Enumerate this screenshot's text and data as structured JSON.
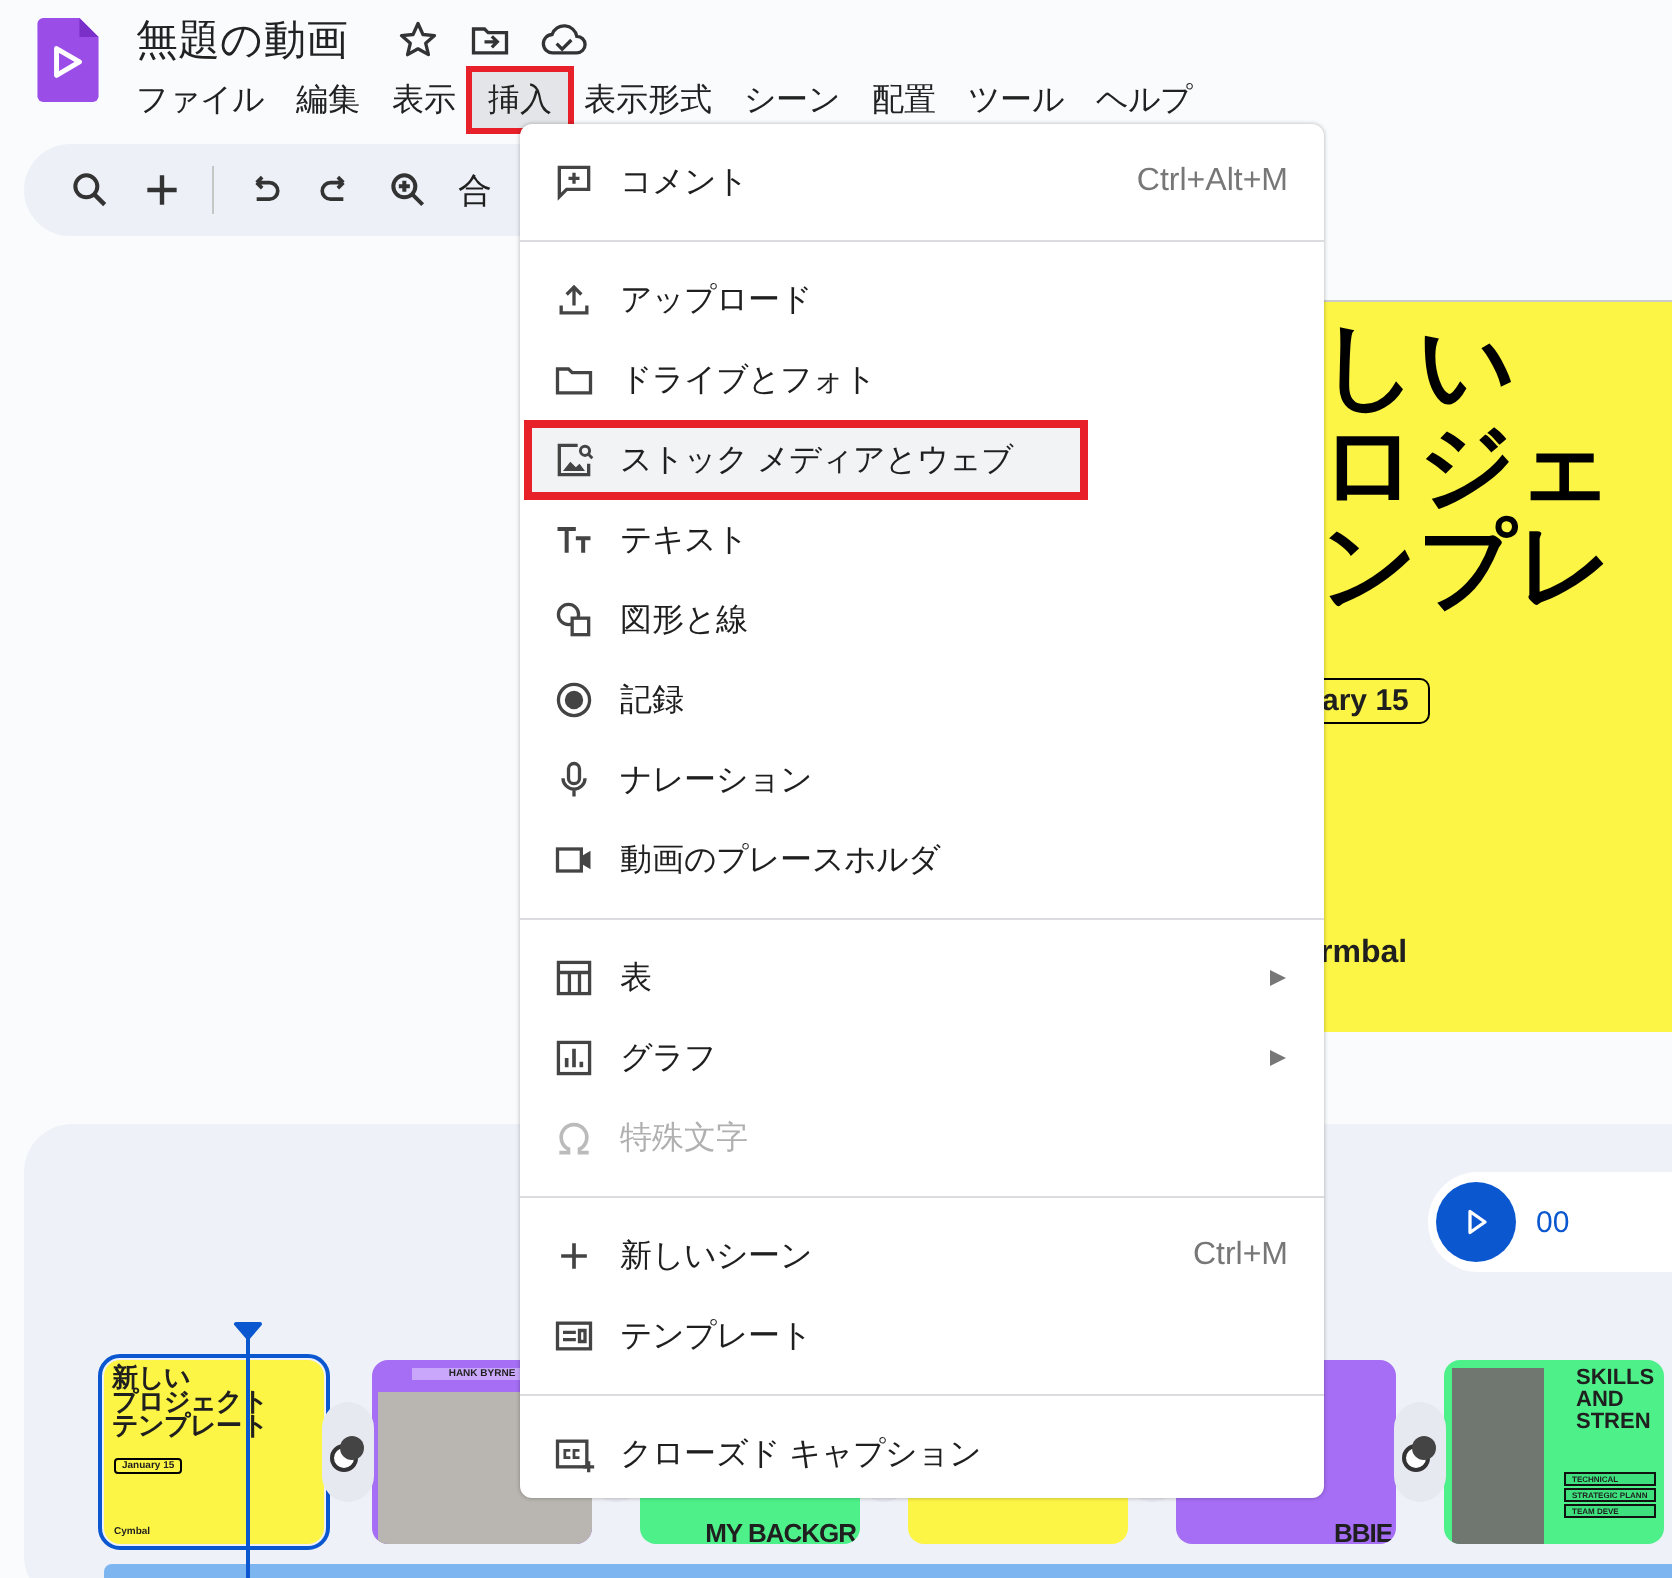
{
  "document": {
    "title": "無題の動画"
  },
  "menubar": [
    {
      "label": "ファイル",
      "selected": false
    },
    {
      "label": "編集",
      "selected": false
    },
    {
      "label": "表示",
      "selected": false
    },
    {
      "label": "挿入",
      "selected": true
    },
    {
      "label": "表示形式",
      "selected": false
    },
    {
      "label": "シーン",
      "selected": false
    },
    {
      "label": "配置",
      "selected": false
    },
    {
      "label": "ツール",
      "selected": false
    },
    {
      "label": "ヘルプ",
      "selected": false
    }
  ],
  "toolbar": {
    "partial_label": "合"
  },
  "insert_menu": {
    "groups": [
      [
        {
          "kind": "comment",
          "label": "コメント",
          "shortcut": "Ctrl+Alt+M",
          "selected": false,
          "disabled": false,
          "submenu": false
        }
      ],
      [
        {
          "kind": "upload",
          "label": "アップロード",
          "selected": false,
          "disabled": false,
          "submenu": false
        },
        {
          "kind": "folder",
          "label": "ドライブとフォト",
          "selected": false,
          "disabled": false,
          "submenu": false
        },
        {
          "kind": "stock",
          "label": "ストック メディアとウェブ",
          "selected": true,
          "disabled": false,
          "submenu": false
        },
        {
          "kind": "text",
          "label": "テキスト",
          "selected": false,
          "disabled": false,
          "submenu": false
        },
        {
          "kind": "shapes",
          "label": "図形と線",
          "selected": false,
          "disabled": false,
          "submenu": false
        },
        {
          "kind": "record",
          "label": "記録",
          "selected": false,
          "disabled": false,
          "submenu": false
        },
        {
          "kind": "mic",
          "label": "ナレーション",
          "selected": false,
          "disabled": false,
          "submenu": false
        },
        {
          "kind": "video",
          "label": "動画のプレースホルダ",
          "selected": false,
          "disabled": false,
          "submenu": false
        }
      ],
      [
        {
          "kind": "table",
          "label": "表",
          "selected": false,
          "disabled": false,
          "submenu": true
        },
        {
          "kind": "chart",
          "label": "グラフ",
          "selected": false,
          "disabled": false,
          "submenu": true
        },
        {
          "kind": "omega",
          "label": "特殊文字",
          "selected": false,
          "disabled": true,
          "submenu": false
        }
      ],
      [
        {
          "kind": "plus",
          "label": "新しいシーン",
          "shortcut": "Ctrl+M",
          "selected": false,
          "disabled": false,
          "submenu": false
        },
        {
          "kind": "template",
          "label": "テンプレート",
          "selected": false,
          "disabled": false,
          "submenu": false
        }
      ],
      [
        {
          "kind": "caption",
          "label": "クローズド キャプション",
          "selected": false,
          "disabled": false,
          "submenu": false
        }
      ]
    ]
  },
  "slide": {
    "title_lines": [
      "しい",
      "ロジェ",
      "ンプレ"
    ],
    "date": "ary 15",
    "brand": "rmbal"
  },
  "timeline": {
    "time": "00",
    "scenes": [
      {
        "color": "#fdf545",
        "selected": true,
        "lines": [
          "新しい",
          "プロジェクト",
          "テンプレート"
        ],
        "date": "January 15",
        "brand": "Cymbal"
      },
      {
        "color": "#a66ef5",
        "selected": false,
        "header": "HANK BYRNE"
      },
      {
        "color": "#4ef08a",
        "selected": false,
        "caption": "MY BACKGR"
      },
      {
        "color": "#fdf545",
        "selected": false
      },
      {
        "color": "#a66ef5",
        "selected": false,
        "caption": "BBIE"
      },
      {
        "color": "#4ef08a",
        "selected": false,
        "heading": "SKILLS AND STREN",
        "bullets": [
          "TECHNICAL",
          "STRATEGIC PLANN",
          "TEAM DEVE"
        ]
      }
    ]
  }
}
